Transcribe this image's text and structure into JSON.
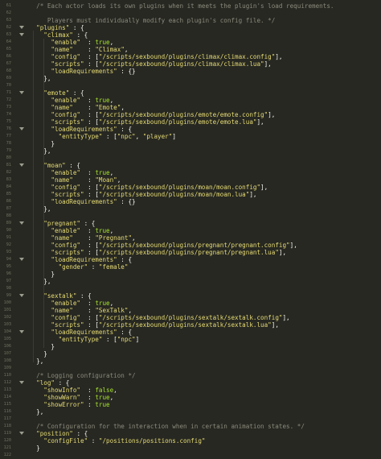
{
  "editor": {
    "lines": [
      {
        "n": "61",
        "fold": false,
        "t": [
          {
            "c": "c",
            "v": "  /* Each actor loads its own plugins when it meets the plugin's load requirements."
          }
        ]
      },
      {
        "n": "62",
        "fold": false,
        "t": []
      },
      {
        "n": "63",
        "fold": false,
        "t": [
          {
            "c": "c",
            "v": "     Players must individually modify each plugin's config file. */"
          }
        ]
      },
      {
        "n": "62",
        "fold": true,
        "t": [
          {
            "c": "s",
            "v": "  \"plugins\""
          },
          {
            "c": "p",
            "v": " : {"
          }
        ]
      },
      {
        "n": "63",
        "fold": true,
        "t": [
          {
            "c": "s",
            "v": "    \"climax\""
          },
          {
            "c": "p",
            "v": " : {"
          }
        ]
      },
      {
        "n": "64",
        "fold": false,
        "t": [
          {
            "c": "s",
            "v": "      \"enable\""
          },
          {
            "c": "p",
            "v": "  : "
          },
          {
            "c": "k",
            "v": "true"
          },
          {
            "c": "p",
            "v": ","
          }
        ]
      },
      {
        "n": "65",
        "fold": false,
        "t": [
          {
            "c": "s",
            "v": "      \"name\""
          },
          {
            "c": "p",
            "v": "    : "
          },
          {
            "c": "s",
            "v": "\"Climax\""
          },
          {
            "c": "p",
            "v": ","
          }
        ]
      },
      {
        "n": "66",
        "fold": false,
        "t": [
          {
            "c": "s",
            "v": "      \"config\""
          },
          {
            "c": "p",
            "v": "  : ["
          },
          {
            "c": "s",
            "v": "\"/scripts/sexbound/plugins/climax/climax.config\""
          },
          {
            "c": "p",
            "v": "],"
          }
        ]
      },
      {
        "n": "67",
        "fold": false,
        "t": [
          {
            "c": "s",
            "v": "      \"scripts\""
          },
          {
            "c": "p",
            "v": " : ["
          },
          {
            "c": "s",
            "v": "\"/scripts/sexbound/plugins/climax/climax.lua\""
          },
          {
            "c": "p",
            "v": "],"
          }
        ]
      },
      {
        "n": "68",
        "fold": false,
        "t": [
          {
            "c": "s",
            "v": "      \"loadRequirements\""
          },
          {
            "c": "p",
            "v": " : {}"
          }
        ]
      },
      {
        "n": "69",
        "fold": false,
        "t": [
          {
            "c": "p",
            "v": "    },"
          }
        ]
      },
      {
        "n": "70",
        "fold": false,
        "t": []
      },
      {
        "n": "71",
        "fold": true,
        "t": [
          {
            "c": "s",
            "v": "    \"emote\""
          },
          {
            "c": "p",
            "v": " : {"
          }
        ]
      },
      {
        "n": "72",
        "fold": false,
        "t": [
          {
            "c": "s",
            "v": "      \"enable\""
          },
          {
            "c": "p",
            "v": "  : "
          },
          {
            "c": "k",
            "v": "true"
          },
          {
            "c": "p",
            "v": ","
          }
        ]
      },
      {
        "n": "73",
        "fold": false,
        "t": [
          {
            "c": "s",
            "v": "      \"name\""
          },
          {
            "c": "p",
            "v": "    : "
          },
          {
            "c": "s",
            "v": "\"Emote\""
          },
          {
            "c": "p",
            "v": ","
          }
        ]
      },
      {
        "n": "74",
        "fold": false,
        "t": [
          {
            "c": "s",
            "v": "      \"config\""
          },
          {
            "c": "p",
            "v": "  : ["
          },
          {
            "c": "s",
            "v": "\"/scripts/sexbound/plugins/emote/emote.config\""
          },
          {
            "c": "p",
            "v": "],"
          }
        ]
      },
      {
        "n": "75",
        "fold": false,
        "t": [
          {
            "c": "s",
            "v": "      \"scripts\""
          },
          {
            "c": "p",
            "v": " : ["
          },
          {
            "c": "s",
            "v": "\"/scripts/sexbound/plugins/emote/emote.lua\""
          },
          {
            "c": "p",
            "v": "],"
          }
        ]
      },
      {
        "n": "76",
        "fold": true,
        "t": [
          {
            "c": "s",
            "v": "      \"loadRequirements\""
          },
          {
            "c": "p",
            "v": " : {"
          }
        ]
      },
      {
        "n": "77",
        "fold": false,
        "t": [
          {
            "c": "s",
            "v": "        \"entityType\""
          },
          {
            "c": "p",
            "v": " : ["
          },
          {
            "c": "s",
            "v": "\"npc\""
          },
          {
            "c": "p",
            "v": ", "
          },
          {
            "c": "s",
            "v": "\"player\""
          },
          {
            "c": "p",
            "v": "]"
          }
        ]
      },
      {
        "n": "78",
        "fold": false,
        "t": [
          {
            "c": "p",
            "v": "      }"
          }
        ]
      },
      {
        "n": "79",
        "fold": false,
        "t": [
          {
            "c": "p",
            "v": "    },"
          }
        ]
      },
      {
        "n": "80",
        "fold": false,
        "t": []
      },
      {
        "n": "81",
        "fold": true,
        "t": [
          {
            "c": "s",
            "v": "    \"moan\""
          },
          {
            "c": "p",
            "v": " : {"
          }
        ]
      },
      {
        "n": "82",
        "fold": false,
        "t": [
          {
            "c": "s",
            "v": "      \"enable\""
          },
          {
            "c": "p",
            "v": "  : "
          },
          {
            "c": "k",
            "v": "true"
          },
          {
            "c": "p",
            "v": ","
          }
        ]
      },
      {
        "n": "83",
        "fold": false,
        "t": [
          {
            "c": "s",
            "v": "      \"name\""
          },
          {
            "c": "p",
            "v": "    : "
          },
          {
            "c": "s",
            "v": "\"Moan\""
          },
          {
            "c": "p",
            "v": ","
          }
        ]
      },
      {
        "n": "84",
        "fold": false,
        "t": [
          {
            "c": "s",
            "v": "      \"config\""
          },
          {
            "c": "p",
            "v": "  : ["
          },
          {
            "c": "s",
            "v": "\"/scripts/sexbound/plugins/moan/moan.config\""
          },
          {
            "c": "p",
            "v": "],"
          }
        ]
      },
      {
        "n": "85",
        "fold": false,
        "t": [
          {
            "c": "s",
            "v": "      \"scripts\""
          },
          {
            "c": "p",
            "v": " : ["
          },
          {
            "c": "s",
            "v": "\"/scripts/sexbound/plugins/moan/moan.lua\""
          },
          {
            "c": "p",
            "v": "],"
          }
        ]
      },
      {
        "n": "86",
        "fold": false,
        "t": [
          {
            "c": "s",
            "v": "      \"loadRequirements\""
          },
          {
            "c": "p",
            "v": " : {}"
          }
        ]
      },
      {
        "n": "87",
        "fold": false,
        "t": [
          {
            "c": "p",
            "v": "    },"
          }
        ]
      },
      {
        "n": "88",
        "fold": false,
        "t": []
      },
      {
        "n": "89",
        "fold": true,
        "t": [
          {
            "c": "s",
            "v": "    \"pregnant\""
          },
          {
            "c": "p",
            "v": " : {"
          }
        ]
      },
      {
        "n": "90",
        "fold": false,
        "t": [
          {
            "c": "s",
            "v": "      \"enable\""
          },
          {
            "c": "p",
            "v": "  : "
          },
          {
            "c": "k",
            "v": "true"
          },
          {
            "c": "p",
            "v": ","
          }
        ]
      },
      {
        "n": "91",
        "fold": false,
        "t": [
          {
            "c": "s",
            "v": "      \"name\""
          },
          {
            "c": "p",
            "v": "    : "
          },
          {
            "c": "s",
            "v": "\"Pregnant\""
          },
          {
            "c": "p",
            "v": ","
          }
        ]
      },
      {
        "n": "92",
        "fold": false,
        "t": [
          {
            "c": "s",
            "v": "      \"config\""
          },
          {
            "c": "p",
            "v": "  : ["
          },
          {
            "c": "s",
            "v": "\"/scripts/sexbound/plugins/pregnant/pregnant.config\""
          },
          {
            "c": "p",
            "v": "],"
          }
        ]
      },
      {
        "n": "93",
        "fold": false,
        "t": [
          {
            "c": "s",
            "v": "      \"scripts\""
          },
          {
            "c": "p",
            "v": " : ["
          },
          {
            "c": "s",
            "v": "\"/scripts/sexbound/plugins/pregnant/pregnant.lua\""
          },
          {
            "c": "p",
            "v": "],"
          }
        ]
      },
      {
        "n": "94",
        "fold": true,
        "t": [
          {
            "c": "s",
            "v": "      \"loadRequirements\""
          },
          {
            "c": "p",
            "v": " : {"
          }
        ]
      },
      {
        "n": "95",
        "fold": false,
        "t": [
          {
            "c": "s",
            "v": "        \"gender\""
          },
          {
            "c": "p",
            "v": " : "
          },
          {
            "c": "s",
            "v": "\"female\""
          }
        ]
      },
      {
        "n": "96",
        "fold": false,
        "t": [
          {
            "c": "p",
            "v": "      }"
          }
        ]
      },
      {
        "n": "97",
        "fold": false,
        "t": [
          {
            "c": "p",
            "v": "    },"
          }
        ]
      },
      {
        "n": "98",
        "fold": false,
        "t": []
      },
      {
        "n": "99",
        "fold": true,
        "t": [
          {
            "c": "s",
            "v": "    \"sextalk\""
          },
          {
            "c": "p",
            "v": " : {"
          }
        ]
      },
      {
        "n": "100",
        "fold": false,
        "t": [
          {
            "c": "s",
            "v": "      \"enable\""
          },
          {
            "c": "p",
            "v": "  : "
          },
          {
            "c": "k",
            "v": "true"
          },
          {
            "c": "p",
            "v": ","
          }
        ]
      },
      {
        "n": "101",
        "fold": false,
        "t": [
          {
            "c": "s",
            "v": "      \"name\""
          },
          {
            "c": "p",
            "v": "    : "
          },
          {
            "c": "s",
            "v": "\"SexTalk\""
          },
          {
            "c": "p",
            "v": ","
          }
        ]
      },
      {
        "n": "102",
        "fold": false,
        "t": [
          {
            "c": "s",
            "v": "      \"config\""
          },
          {
            "c": "p",
            "v": "  : ["
          },
          {
            "c": "s",
            "v": "\"/scripts/sexbound/plugins/sextalk/sextalk.config\""
          },
          {
            "c": "p",
            "v": "],"
          }
        ]
      },
      {
        "n": "103",
        "fold": false,
        "t": [
          {
            "c": "s",
            "v": "      \"scripts\""
          },
          {
            "c": "p",
            "v": " : ["
          },
          {
            "c": "s",
            "v": "\"/scripts/sexbound/plugins/sextalk/sextalk.lua\""
          },
          {
            "c": "p",
            "v": "],"
          }
        ]
      },
      {
        "n": "104",
        "fold": true,
        "t": [
          {
            "c": "s",
            "v": "      \"loadRequirements\""
          },
          {
            "c": "p",
            "v": " : {"
          }
        ]
      },
      {
        "n": "105",
        "fold": false,
        "t": [
          {
            "c": "s",
            "v": "        \"entityType\""
          },
          {
            "c": "p",
            "v": " : ["
          },
          {
            "c": "s",
            "v": "\"npc\""
          },
          {
            "c": "p",
            "v": "]"
          }
        ]
      },
      {
        "n": "106",
        "fold": false,
        "t": [
          {
            "c": "p",
            "v": "      }"
          }
        ]
      },
      {
        "n": "107",
        "fold": false,
        "t": [
          {
            "c": "p",
            "v": "    }"
          }
        ]
      },
      {
        "n": "108",
        "fold": false,
        "t": [
          {
            "c": "p",
            "v": "  },"
          }
        ]
      },
      {
        "n": "109",
        "fold": false,
        "t": []
      },
      {
        "n": "110",
        "fold": false,
        "t": [
          {
            "c": "c",
            "v": "  /* Logging configuration */"
          }
        ]
      },
      {
        "n": "112",
        "fold": true,
        "t": [
          {
            "c": "s",
            "v": "  \"log\""
          },
          {
            "c": "p",
            "v": " : {"
          }
        ]
      },
      {
        "n": "113",
        "fold": false,
        "t": [
          {
            "c": "s",
            "v": "    \"showInfo\""
          },
          {
            "c": "p",
            "v": "  : "
          },
          {
            "c": "k",
            "v": "false"
          },
          {
            "c": "p",
            "v": ","
          }
        ]
      },
      {
        "n": "114",
        "fold": false,
        "t": [
          {
            "c": "s",
            "v": "    \"showWarn\""
          },
          {
            "c": "p",
            "v": "  : "
          },
          {
            "c": "k",
            "v": "true"
          },
          {
            "c": "p",
            "v": ","
          }
        ]
      },
      {
        "n": "115",
        "fold": false,
        "t": [
          {
            "c": "s",
            "v": "    \"showError\""
          },
          {
            "c": "p",
            "v": " : "
          },
          {
            "c": "k",
            "v": "true"
          }
        ]
      },
      {
        "n": "116",
        "fold": false,
        "t": [
          {
            "c": "p",
            "v": "  },"
          }
        ]
      },
      {
        "n": "117",
        "fold": false,
        "t": []
      },
      {
        "n": "118",
        "fold": false,
        "t": [
          {
            "c": "c",
            "v": "  /* Configuration for the interaction when in certain animation states. */"
          }
        ]
      },
      {
        "n": "119",
        "fold": true,
        "t": [
          {
            "c": "s",
            "v": "  \"position\""
          },
          {
            "c": "p",
            "v": " : {"
          }
        ]
      },
      {
        "n": "120",
        "fold": false,
        "t": [
          {
            "c": "s",
            "v": "    \"configFile\""
          },
          {
            "c": "p",
            "v": " : "
          },
          {
            "c": "s",
            "v": "\"/positions/positions.config\""
          }
        ]
      },
      {
        "n": "121",
        "fold": false,
        "t": [
          {
            "c": "p",
            "v": "  }"
          }
        ]
      },
      {
        "n": "122",
        "fold": false,
        "t": []
      }
    ]
  }
}
